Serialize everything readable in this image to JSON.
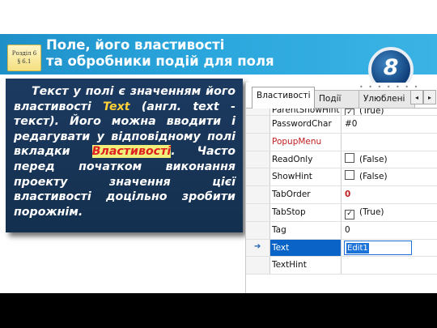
{
  "header": {
    "badge_line1": "Розділ 6",
    "badge_line2": "§ 6.1",
    "title_line1": "Поле, його властивості",
    "title_line2": "та обробники подій для поля",
    "grade": "8"
  },
  "textbox": {
    "part1": "Текст у полі є значенням його властивості ",
    "highlight1": "Text",
    "part2": " (англ. text - текст). Його можна вводити і редагувати у відповідному полі вкладки ",
    "highlight2": "Властивості",
    "part3": ". Часто перед початком виконання проекту значення цієї властивості доцільно зробити порожнім."
  },
  "inspector": {
    "dots": "• • • • • • •",
    "tabs": [
      "Властивості",
      "Події",
      "Улюблені"
    ],
    "arrow_left": "◂",
    "arrow_right": "▸",
    "rows": [
      {
        "name": "ParentShowHint",
        "value": "(True)"
      },
      {
        "name": "PasswordChar",
        "value": "#0"
      },
      {
        "name": "PopupMenu",
        "value": ""
      },
      {
        "name": "ReadOnly",
        "value": "(False)"
      },
      {
        "name": "ShowHint",
        "value": "(False)"
      },
      {
        "name": "TabOrder",
        "value": "0"
      },
      {
        "name": "TabStop",
        "value": "(True)"
      },
      {
        "name": "Tag",
        "value": "0"
      },
      {
        "name": "Text",
        "value": "Edit1"
      },
      {
        "name": "TextHint",
        "value": ""
      }
    ],
    "checkmark": "✓",
    "selected_marker": "➔"
  },
  "colors": {
    "header_blue": "#2aa6dd",
    "textbox_bg": "#1c3a60",
    "highlight_yellow": "#ffd23a",
    "highlight_red": "#e02121",
    "selection_blue": "#0a64c8"
  }
}
